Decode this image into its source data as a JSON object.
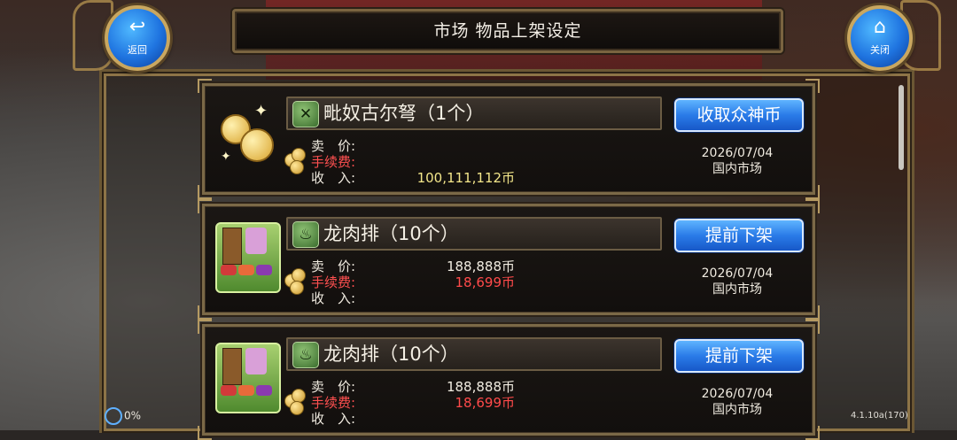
{
  "title": "市场 物品上架设定",
  "nav": {
    "back_label": "返回",
    "close_label": "关闭"
  },
  "listings": [
    {
      "item_name": "毗奴古尔弩（1个）",
      "icon": "crossbow-icon",
      "thumb": "gold-coins-thumb",
      "action_label": "收取众神币",
      "price_label": "卖　价:",
      "fee_label": "手续费:",
      "income_label": "收　入:",
      "price": "",
      "fee": "",
      "income": "100,111,112币",
      "date": "2026/07/04",
      "market": "国内市场"
    },
    {
      "item_name": "龙肉排（10个）",
      "icon": "pot-icon",
      "thumb": "market-stall-thumb",
      "action_label": "提前下架",
      "price_label": "卖　价:",
      "fee_label": "手续费:",
      "income_label": "收　入:",
      "price": "188,888币",
      "fee": "18,699币",
      "income": "",
      "date": "2026/07/04",
      "market": "国内市场"
    },
    {
      "item_name": "龙肉排（10个）",
      "icon": "pot-icon",
      "thumb": "market-stall-thumb",
      "action_label": "提前下架",
      "price_label": "卖　价:",
      "fee_label": "手续费:",
      "income_label": "收　入:",
      "price": "188,888币",
      "fee": "18,699币",
      "income": "",
      "date": "2026/07/04",
      "market": "国内市场"
    }
  ],
  "status": {
    "battery": "0%",
    "version": "4.1.10a(170)"
  },
  "colors": {
    "button_blue": "#2a7be8",
    "fee_red": "#ff4a4a",
    "income_yellow": "#f3e68a",
    "frame_gold": "#7b6947"
  }
}
